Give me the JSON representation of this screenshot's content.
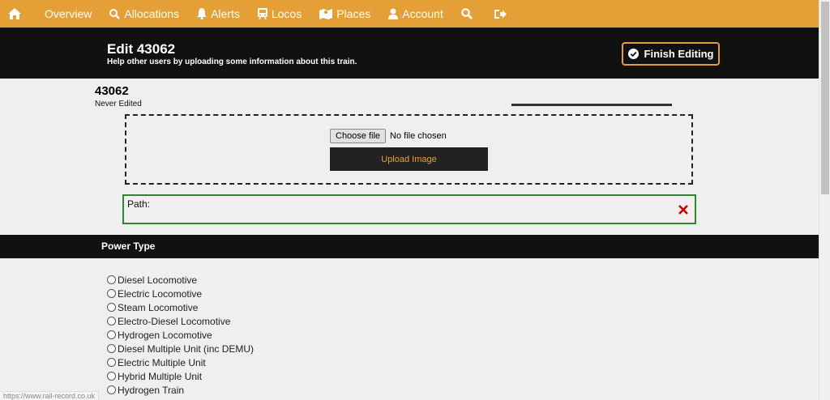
{
  "nav": {
    "items": [
      {
        "label": "Overview",
        "icon": "home-icon"
      },
      {
        "label": "Allocations",
        "icon": "search-icon"
      },
      {
        "label": "Alerts",
        "icon": "bell-icon"
      },
      {
        "label": "Locos",
        "icon": "train-icon"
      },
      {
        "label": "Places",
        "icon": "map-icon"
      },
      {
        "label": "Account",
        "icon": "user-icon"
      }
    ]
  },
  "header": {
    "title": "Edit 43062",
    "subtitle": "Help other users by uploading some information about this train.",
    "finish_label": "Finish Editing"
  },
  "loco": {
    "number": "43062",
    "status": "Never Edited"
  },
  "upload": {
    "choose_label": "Choose file",
    "no_file_text": "No file chosen",
    "upload_label": "Upload Image"
  },
  "path": {
    "label": "Path:"
  },
  "power_type": {
    "title": "Power Type",
    "options": [
      "Diesel Locomotive",
      "Electric Locomotive",
      "Steam Locomotive",
      "Electro-Diesel Locomotive",
      "Hydrogen Locomotive",
      "Diesel Multiple Unit (inc DEMU)",
      "Electric Multiple Unit",
      "Hybrid Multiple Unit",
      "Hydrogen Train"
    ]
  },
  "status_bar": {
    "url": "https://www.rail-record.co.uk"
  },
  "colors": {
    "accent": "#e59f37",
    "dark": "#111111",
    "success": "#2a8a2a",
    "danger": "#d00000"
  }
}
